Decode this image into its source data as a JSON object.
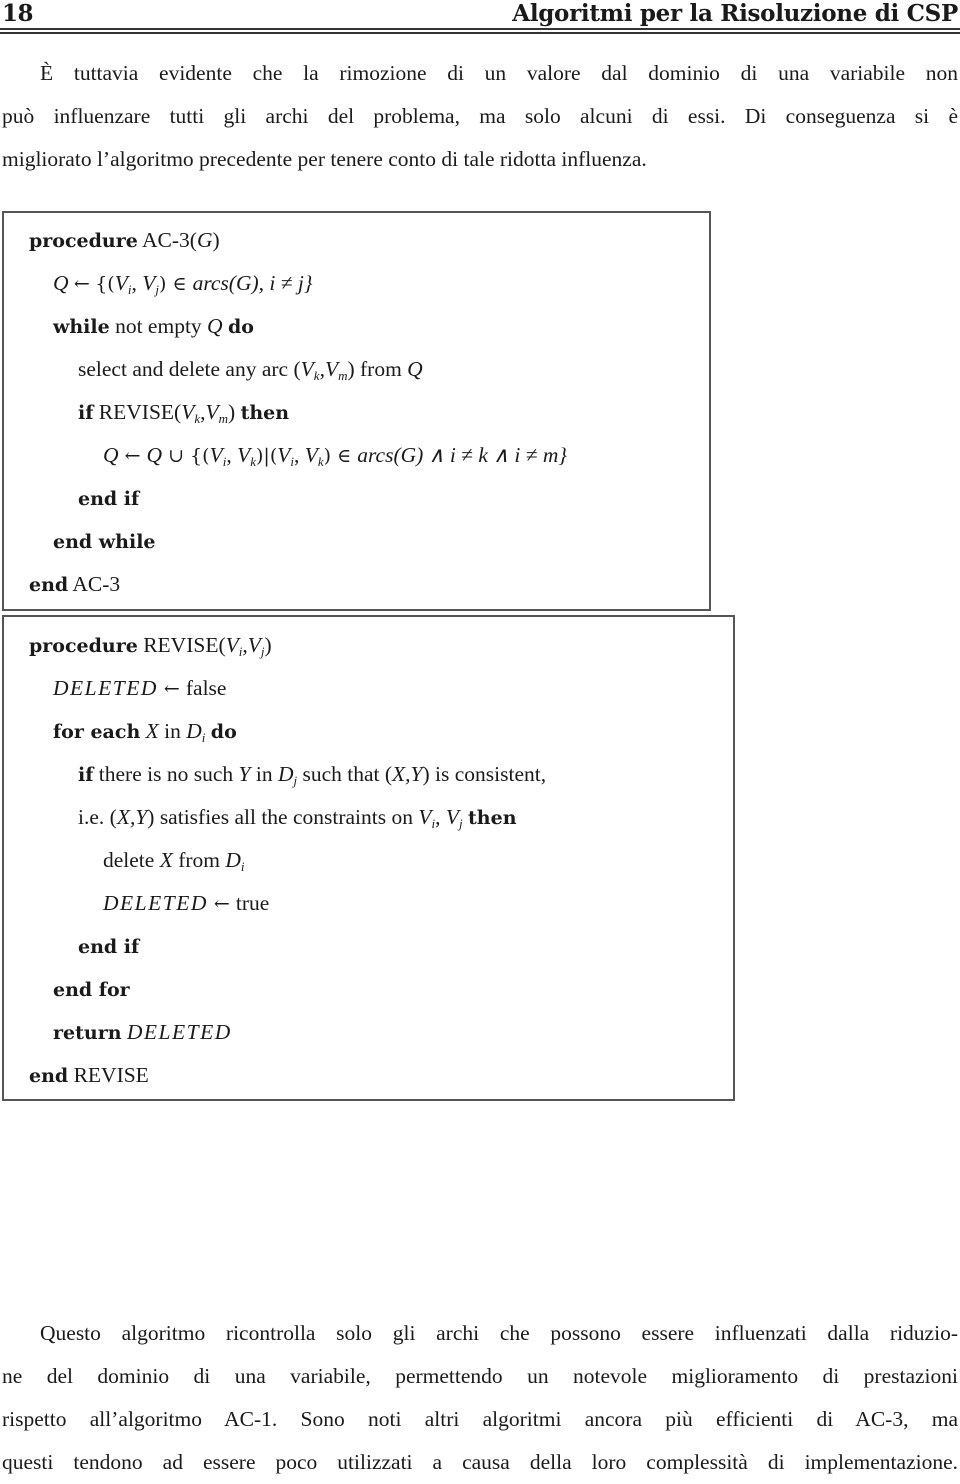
{
  "header": {
    "page_number": "18",
    "running_title": "Algoritmi per la Risoluzione di CSP"
  },
  "intro_paragraph": {
    "lines": [
      "È tuttavia evidente che la rimozione di un valore dal dominio di una variabile non",
      "può influenzare tutti gli archi del problema, ma solo alcuni di essi. Di conseguenza si è",
      "migliorato l’algoritmo precedente per tenere conto di tale ridotta influenza."
    ]
  },
  "ac3_procedure": {
    "kw_procedure": "procedure",
    "name": "AC-3(",
    "param": "G",
    "close": ")",
    "line_q_init": {
      "q": "Q",
      "arrow": "←",
      "set_open": "{(",
      "v": "V",
      "i": "i",
      "comma": ", ",
      "j": "j",
      "in_arcs": ") ∈ ",
      "arcs": "arcs",
      "g": "(G)",
      "cond": ", i ≠ j}"
    },
    "kw_while": "while",
    "while_text": " not empty ",
    "while_q": "Q",
    "kw_do": "do",
    "select_text": "select and delete any arc (",
    "select_vk": "V",
    "select_k": "k",
    "select_comma": ",",
    "select_vm": "V",
    "select_m": "m",
    "select_from": ") from ",
    "select_q": "Q",
    "kw_if": "if",
    "revise_call": " REVISE(",
    "revise_k": "k",
    "revise_m": "m",
    "revise_close": ") ",
    "kw_then": "then",
    "update_line": {
      "lhs": "Q",
      "arrow": " ← ",
      "q": "Q",
      "union": " ∪ {(",
      "tail": ") ∈ ",
      "arcs": "arcs",
      "g": "(G)",
      "cond": " ∧ i ≠ k ∧ i ≠ m}"
    },
    "end_if": "end if",
    "end_while": "end while",
    "kw_end": "end",
    "end_name": " AC-3"
  },
  "revise_procedure": {
    "kw_procedure": "procedure",
    "name": " REVISE(",
    "close": ")",
    "deleted": "DELETED",
    "arrow": " ← ",
    "false_val": "false",
    "true_val": "true",
    "kw_for_each": "for each",
    "for_x": "X",
    "for_in": " in ",
    "for_d": "D",
    "kw_do": "do",
    "kw_if": "if",
    "if_text1": " there is no such ",
    "if_y": "Y",
    "if_in": " in ",
    "if_text2": " such that (",
    "if_xy": "X,Y",
    "if_text3": ") is consistent,",
    "ie_text1": "i.e. (",
    "ie_text2": ") satisfies all the constraints on ",
    "kw_then": "then",
    "delete_text": "delete ",
    "delete_from": " from ",
    "end_if": "end if",
    "end_for": "end for",
    "kw_return": "return",
    "kw_end": "end",
    "end_name": " REVISE"
  },
  "closing_paragraph": {
    "lines": [
      "Questo algoritmo ricontrolla solo gli archi che possono essere influenzati dalla riduzio-",
      "ne del dominio di una variabile, permettendo un notevole miglioramento di prestazioni",
      "rispetto all’algoritmo AC-1. Sono noti altri algoritmi ancora più efficienti di AC-3, ma",
      "questi tendono ad essere poco utilizzati a causa della loro complessità di implementazione."
    ]
  }
}
